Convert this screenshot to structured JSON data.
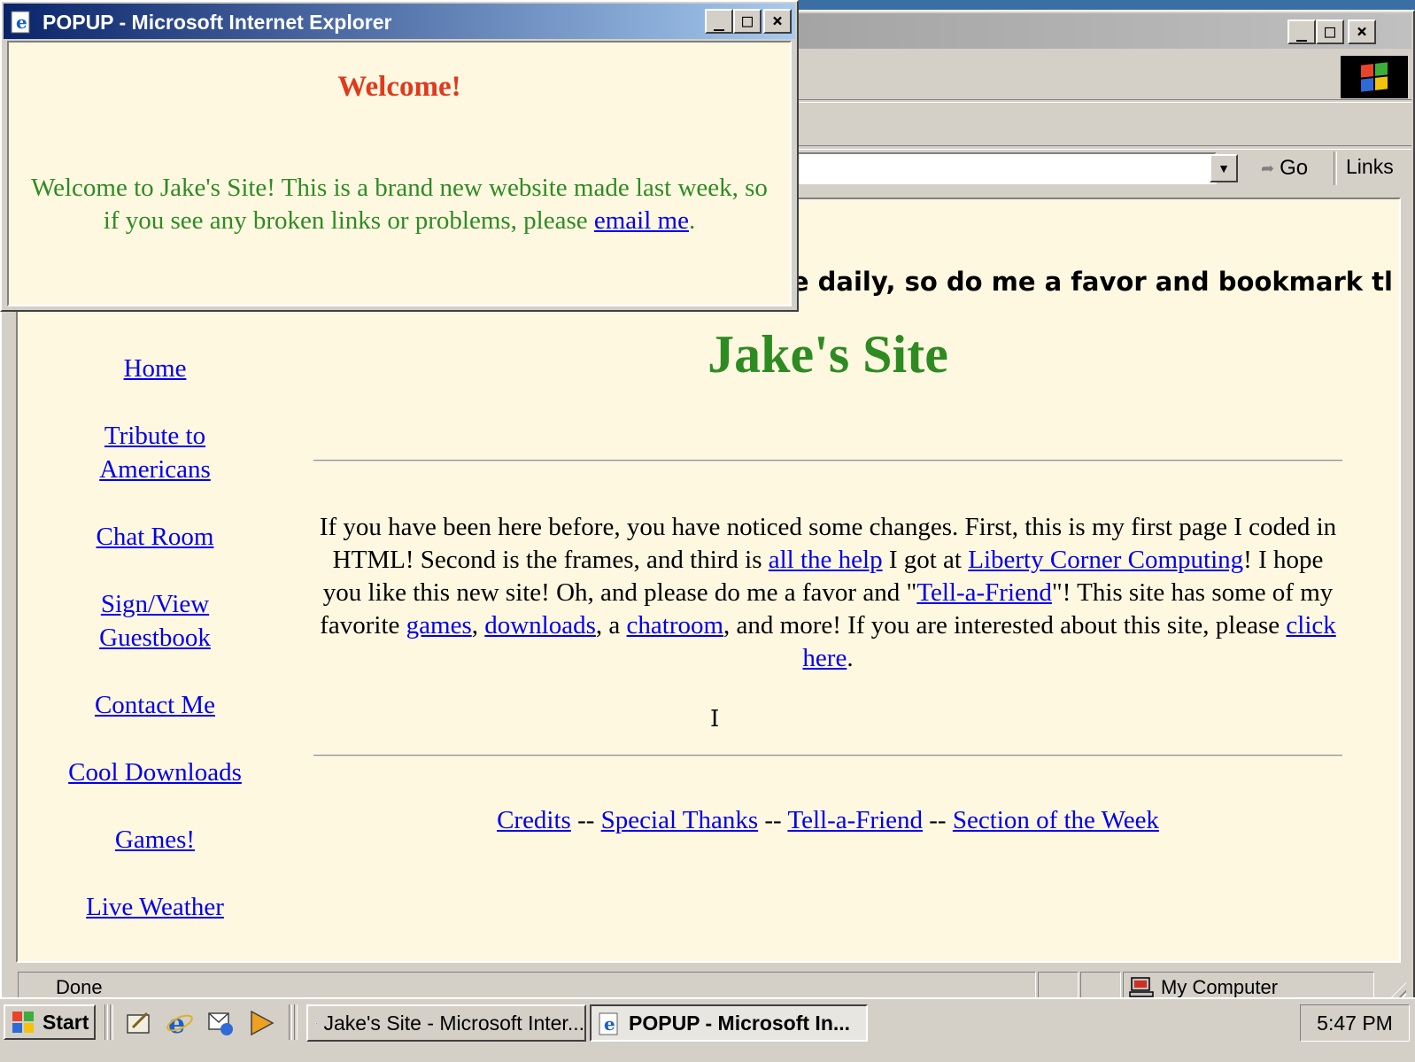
{
  "main_window": {
    "title_buttons": {
      "minimize": "_",
      "maximize": "□",
      "close": "×"
    },
    "address_bar": {
      "value": "",
      "go_label": "Go",
      "links_label": "Links"
    },
    "marquee_text": "te daily, so do me a favor and bookmark tl",
    "site_title": "Jake's Site",
    "nav": [
      "Home",
      "Tribute to Americans",
      "Chat Room",
      "Sign/View Guestbook",
      "Contact Me",
      "Cool Downloads",
      "Games!",
      "Live Weather"
    ],
    "intro": {
      "t1": "If you have been here before, you have noticed some changes. First, this is my first page I coded in HTML! Second is the frames, and third is ",
      "link_help": "all the help",
      "t2": " I got at ",
      "link_liberty": "Liberty Corner Computing",
      "t3": "! I hope you like this new site! Oh, and please do me a favor and \"",
      "link_tell": "Tell-a-Friend",
      "t4": "\"! This site has some of my favorite ",
      "link_games": "games",
      "t5": ", ",
      "link_downloads": "downloads",
      "t6": ", a ",
      "link_chatroom": "chatroom",
      "t7": ", and more! If you are interested about this site, please ",
      "link_click": "click here",
      "t8": "."
    },
    "footer": {
      "credits": "Credits",
      "thanks": "Special Thanks",
      "tell": "Tell-a-Friend",
      "section": "Section of the Week",
      "sep": " -- "
    },
    "status": {
      "text": "Done",
      "zone": "My Computer"
    }
  },
  "popup": {
    "title": "POPUP - Microsoft Internet Explorer",
    "heading": "Welcome!",
    "text_before": "Welcome to Jake's Site! This is a brand new website made last week, so if you see any broken links or problems, please ",
    "link": "email me",
    "text_after": "."
  },
  "taskbar": {
    "start_label": "Start",
    "tasks": [
      {
        "label": "Jake's Site - Microsoft Inter...",
        "active": false
      },
      {
        "label": "POPUP - Microsoft In...",
        "active": true
      }
    ],
    "clock": "5:47 PM"
  },
  "colors": {
    "page_bg": "#fff8e1",
    "site_title": "#2e8b22",
    "popup_heading": "#e03a1e",
    "link": "#0000ee",
    "active_title": "#0a246a",
    "desktop": "#3a6ea5"
  },
  "icons": [
    "ie-icon",
    "windows-logo-icon",
    "go-arrow-icon",
    "computer-icon",
    "start-logo-icon",
    "show-desktop-icon",
    "outlook-icon",
    "media-player-icon"
  ]
}
